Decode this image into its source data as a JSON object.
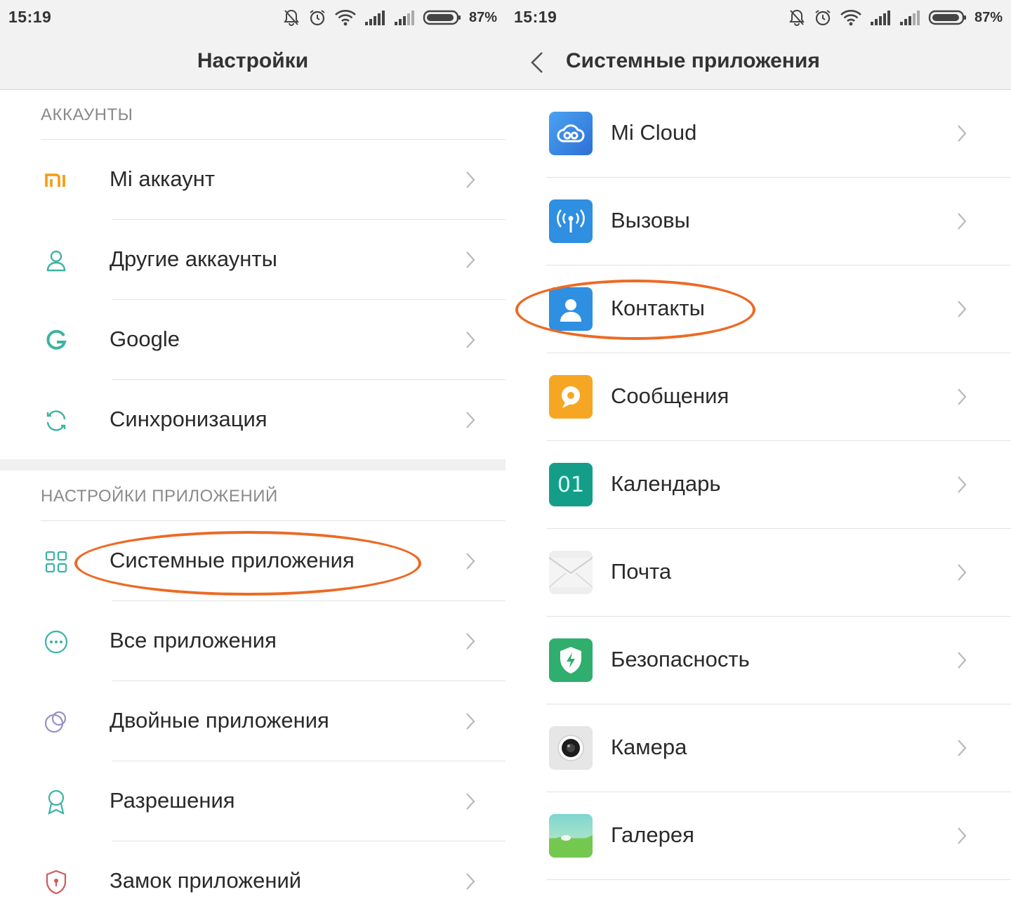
{
  "status_bar": {
    "time": "15:19",
    "battery_percent": "87%",
    "icons": [
      "silent-icon",
      "alarm-icon",
      "wifi-icon",
      "signal-icon",
      "signal-icon",
      "battery-icon"
    ]
  },
  "left_screen": {
    "title": "Настройки",
    "sections": [
      {
        "header": "АККАУНТЫ",
        "items": [
          {
            "label": "Mi аккаунт",
            "icon": "mi-logo-icon"
          },
          {
            "label": "Другие аккаунты",
            "icon": "person-icon"
          },
          {
            "label": "Google",
            "icon": "google-g-icon"
          },
          {
            "label": "Синхронизация",
            "icon": "sync-icon"
          }
        ]
      },
      {
        "header": "НАСТРОЙКИ ПРИЛОЖЕНИЙ",
        "items": [
          {
            "label": "Системные приложения",
            "icon": "grid-icon",
            "highlighted": true
          },
          {
            "label": "Все приложения",
            "icon": "more-dots-icon"
          },
          {
            "label": "Двойные приложения",
            "icon": "dual-circles-icon"
          },
          {
            "label": "Разрешения",
            "icon": "ribbon-icon"
          },
          {
            "label": "Замок приложений",
            "icon": "lock-shield-icon"
          }
        ]
      }
    ]
  },
  "right_screen": {
    "title": "Системные приложения",
    "items": [
      {
        "label": "Mi Cloud",
        "icon": "cloud-icon"
      },
      {
        "label": "Вызовы",
        "icon": "antenna-icon"
      },
      {
        "label": "Контакты",
        "icon": "contact-person-icon",
        "highlighted": true
      },
      {
        "label": "Сообщения",
        "icon": "message-bubble-icon"
      },
      {
        "label": "Календарь",
        "icon": "calendar-icon",
        "icon_text": "01"
      },
      {
        "label": "Почта",
        "icon": "envelope-icon"
      },
      {
        "label": "Безопасность",
        "icon": "security-shield-icon"
      },
      {
        "label": "Камера",
        "icon": "camera-icon"
      },
      {
        "label": "Галерея",
        "icon": "gallery-icon"
      }
    ]
  },
  "colors": {
    "accent_teal": "#3cb3a3",
    "highlight_ring": "#ec6a24",
    "mi_orange": "#f39c12",
    "header_gray": "#8a8a8a"
  }
}
